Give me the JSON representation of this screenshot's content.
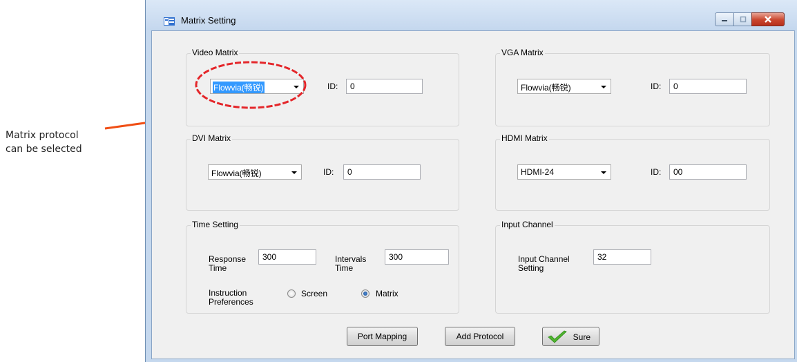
{
  "annotation": {
    "line1": "Matrix protocol",
    "line2": "can be selected",
    "arrow_color": "#f04e14"
  },
  "window": {
    "title": "Matrix Setting",
    "icons": {
      "app": "app-window-icon",
      "minimize": "minimize-icon",
      "maximize": "maximize-icon",
      "close": "close-icon"
    }
  },
  "video_matrix": {
    "title": "Video Matrix",
    "protocol": "Flowvia(畅锐)",
    "id_label": "ID:",
    "id_value": "0"
  },
  "vga_matrix": {
    "title": "VGA Matrix",
    "protocol": "Flowvia(畅锐)",
    "id_label": "ID:",
    "id_value": "0"
  },
  "dvi_matrix": {
    "title": "DVI Matrix",
    "protocol": "Flowvia(畅锐)",
    "id_label": "ID:",
    "id_value": "0"
  },
  "hdmi_matrix": {
    "title": "HDMI Matrix",
    "protocol": "HDMI-24",
    "id_label": "ID:",
    "id_value": "00"
  },
  "time_setting": {
    "title": "Time Setting",
    "response_label_1": "Response",
    "response_label_2": "Time",
    "response_value": "300",
    "intervals_label_1": "Intervals",
    "intervals_label_2": "Time",
    "intervals_value": "300",
    "instruction_label_1": "Instruction",
    "instruction_label_2": "Preferences",
    "options": [
      "Screen",
      "Matrix"
    ],
    "selected": "Matrix"
  },
  "input_channel": {
    "title": "Input Channel",
    "setting_label_1": "Input Channel",
    "setting_label_2": "Setting",
    "value": "32"
  },
  "buttons": {
    "port_mapping": "Port Mapping",
    "add_protocol": "Add Protocol",
    "sure": "Sure"
  },
  "colors": {
    "highlight_ellipse": "#e4262a",
    "selection": "#3399ff",
    "check": "#4fb32e"
  }
}
